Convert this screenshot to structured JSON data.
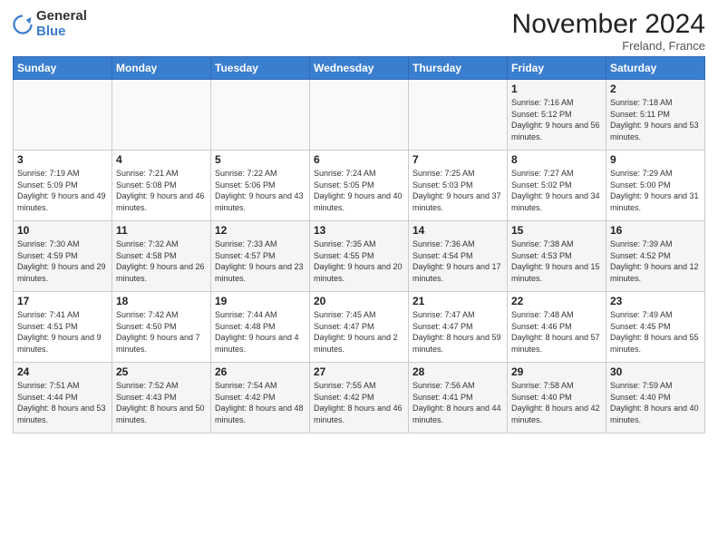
{
  "logo": {
    "general": "General",
    "blue": "Blue"
  },
  "title": "November 2024",
  "location": "Freland, France",
  "weekdays": [
    "Sunday",
    "Monday",
    "Tuesday",
    "Wednesday",
    "Thursday",
    "Friday",
    "Saturday"
  ],
  "weeks": [
    [
      {
        "day": "",
        "info": ""
      },
      {
        "day": "",
        "info": ""
      },
      {
        "day": "",
        "info": ""
      },
      {
        "day": "",
        "info": ""
      },
      {
        "day": "",
        "info": ""
      },
      {
        "day": "1",
        "info": "Sunrise: 7:16 AM\nSunset: 5:12 PM\nDaylight: 9 hours and 56 minutes."
      },
      {
        "day": "2",
        "info": "Sunrise: 7:18 AM\nSunset: 5:11 PM\nDaylight: 9 hours and 53 minutes."
      }
    ],
    [
      {
        "day": "3",
        "info": "Sunrise: 7:19 AM\nSunset: 5:09 PM\nDaylight: 9 hours and 49 minutes."
      },
      {
        "day": "4",
        "info": "Sunrise: 7:21 AM\nSunset: 5:08 PM\nDaylight: 9 hours and 46 minutes."
      },
      {
        "day": "5",
        "info": "Sunrise: 7:22 AM\nSunset: 5:06 PM\nDaylight: 9 hours and 43 minutes."
      },
      {
        "day": "6",
        "info": "Sunrise: 7:24 AM\nSunset: 5:05 PM\nDaylight: 9 hours and 40 minutes."
      },
      {
        "day": "7",
        "info": "Sunrise: 7:25 AM\nSunset: 5:03 PM\nDaylight: 9 hours and 37 minutes."
      },
      {
        "day": "8",
        "info": "Sunrise: 7:27 AM\nSunset: 5:02 PM\nDaylight: 9 hours and 34 minutes."
      },
      {
        "day": "9",
        "info": "Sunrise: 7:29 AM\nSunset: 5:00 PM\nDaylight: 9 hours and 31 minutes."
      }
    ],
    [
      {
        "day": "10",
        "info": "Sunrise: 7:30 AM\nSunset: 4:59 PM\nDaylight: 9 hours and 29 minutes."
      },
      {
        "day": "11",
        "info": "Sunrise: 7:32 AM\nSunset: 4:58 PM\nDaylight: 9 hours and 26 minutes."
      },
      {
        "day": "12",
        "info": "Sunrise: 7:33 AM\nSunset: 4:57 PM\nDaylight: 9 hours and 23 minutes."
      },
      {
        "day": "13",
        "info": "Sunrise: 7:35 AM\nSunset: 4:55 PM\nDaylight: 9 hours and 20 minutes."
      },
      {
        "day": "14",
        "info": "Sunrise: 7:36 AM\nSunset: 4:54 PM\nDaylight: 9 hours and 17 minutes."
      },
      {
        "day": "15",
        "info": "Sunrise: 7:38 AM\nSunset: 4:53 PM\nDaylight: 9 hours and 15 minutes."
      },
      {
        "day": "16",
        "info": "Sunrise: 7:39 AM\nSunset: 4:52 PM\nDaylight: 9 hours and 12 minutes."
      }
    ],
    [
      {
        "day": "17",
        "info": "Sunrise: 7:41 AM\nSunset: 4:51 PM\nDaylight: 9 hours and 9 minutes."
      },
      {
        "day": "18",
        "info": "Sunrise: 7:42 AM\nSunset: 4:50 PM\nDaylight: 9 hours and 7 minutes."
      },
      {
        "day": "19",
        "info": "Sunrise: 7:44 AM\nSunset: 4:48 PM\nDaylight: 9 hours and 4 minutes."
      },
      {
        "day": "20",
        "info": "Sunrise: 7:45 AM\nSunset: 4:47 PM\nDaylight: 9 hours and 2 minutes."
      },
      {
        "day": "21",
        "info": "Sunrise: 7:47 AM\nSunset: 4:47 PM\nDaylight: 8 hours and 59 minutes."
      },
      {
        "day": "22",
        "info": "Sunrise: 7:48 AM\nSunset: 4:46 PM\nDaylight: 8 hours and 57 minutes."
      },
      {
        "day": "23",
        "info": "Sunrise: 7:49 AM\nSunset: 4:45 PM\nDaylight: 8 hours and 55 minutes."
      }
    ],
    [
      {
        "day": "24",
        "info": "Sunrise: 7:51 AM\nSunset: 4:44 PM\nDaylight: 8 hours and 53 minutes."
      },
      {
        "day": "25",
        "info": "Sunrise: 7:52 AM\nSunset: 4:43 PM\nDaylight: 8 hours and 50 minutes."
      },
      {
        "day": "26",
        "info": "Sunrise: 7:54 AM\nSunset: 4:42 PM\nDaylight: 8 hours and 48 minutes."
      },
      {
        "day": "27",
        "info": "Sunrise: 7:55 AM\nSunset: 4:42 PM\nDaylight: 8 hours and 46 minutes."
      },
      {
        "day": "28",
        "info": "Sunrise: 7:56 AM\nSunset: 4:41 PM\nDaylight: 8 hours and 44 minutes."
      },
      {
        "day": "29",
        "info": "Sunrise: 7:58 AM\nSunset: 4:40 PM\nDaylight: 8 hours and 42 minutes."
      },
      {
        "day": "30",
        "info": "Sunrise: 7:59 AM\nSunset: 4:40 PM\nDaylight: 8 hours and 40 minutes."
      }
    ]
  ]
}
